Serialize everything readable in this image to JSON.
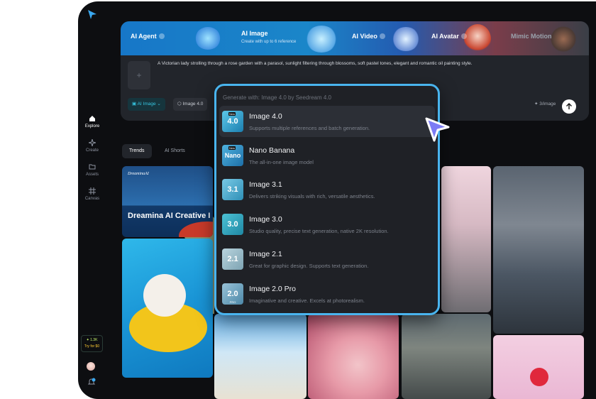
{
  "sidebar": {
    "items": [
      {
        "label": "Explore",
        "icon": "home-icon",
        "active": true
      },
      {
        "label": "Create",
        "icon": "sparkle-icon",
        "active": false
      },
      {
        "label": "Assets",
        "icon": "folder-icon",
        "active": false
      },
      {
        "label": "Canvas",
        "icon": "canvas-icon",
        "active": false
      }
    ],
    "credits": {
      "amount": "✦ 1.3K",
      "cta": "Try for $0"
    }
  },
  "hero": {
    "tabs": [
      {
        "label": "AI Agent",
        "sub": ""
      },
      {
        "label": "AI Image",
        "sub": "Create with up to 6 reference"
      },
      {
        "label": "AI Video",
        "sub": ""
      },
      {
        "label": "AI Avatar",
        "sub": ""
      },
      {
        "label": "Mimic Motion",
        "sub": ""
      }
    ],
    "prompt": "A Victorian lady strolling through a rose garden with a parasol, sunlight filtering through blossoms, soft pastel tones, elegant and romantic oil painting style.",
    "upload_symbol": "+",
    "mode_pill": "AI Image",
    "model_pill": "Image 4.0",
    "cost": "✦ 3/image"
  },
  "category_tabs": [
    "Trends",
    "AI Shorts"
  ],
  "gallery": {
    "brand": "DreaminaAI",
    "feature_title": "Dreamina AI Creative I"
  },
  "dropdown": {
    "header": "Generate with: Image 4.0 by Seedream 4.0",
    "selected_index": 0,
    "items": [
      {
        "name": "Image 4.0",
        "desc": "Supports multiple references and batch generation.",
        "thumb": "4.0",
        "badge": "New",
        "thumb_color": "#1c7fb0"
      },
      {
        "name": "Nano Banana",
        "desc": "The all-in-one image model",
        "thumb": "Nano",
        "badge": "New",
        "thumb_color": "#1d6fa8"
      },
      {
        "name": "Image 3.1",
        "desc": "Delivers striking visuals with rich, versatile aesthetics.",
        "thumb": "3.1",
        "badge": "",
        "thumb_color": "#2f8fb6"
      },
      {
        "name": "Image 3.0",
        "desc": "Studio quality, precise text generation, native 2K resolution.",
        "thumb": "3.0",
        "badge": "",
        "thumb_color": "#1f88a4"
      },
      {
        "name": "Image 2.1",
        "desc": "Great for graphic design. Supports text generation.",
        "thumb": "2.1",
        "badge": "",
        "thumb_color": "#7da3b2"
      },
      {
        "name": "Image 2.0 Pro",
        "desc": "Imaginative and creative. Excels at photorealism.",
        "thumb": "2.0",
        "badge": "",
        "tag": "PRO",
        "thumb_color": "#4d88a8"
      }
    ]
  },
  "colors": {
    "accent": "#49b4ee",
    "cursor": "#7c7cf5",
    "app_bg": "#0d0e11"
  }
}
